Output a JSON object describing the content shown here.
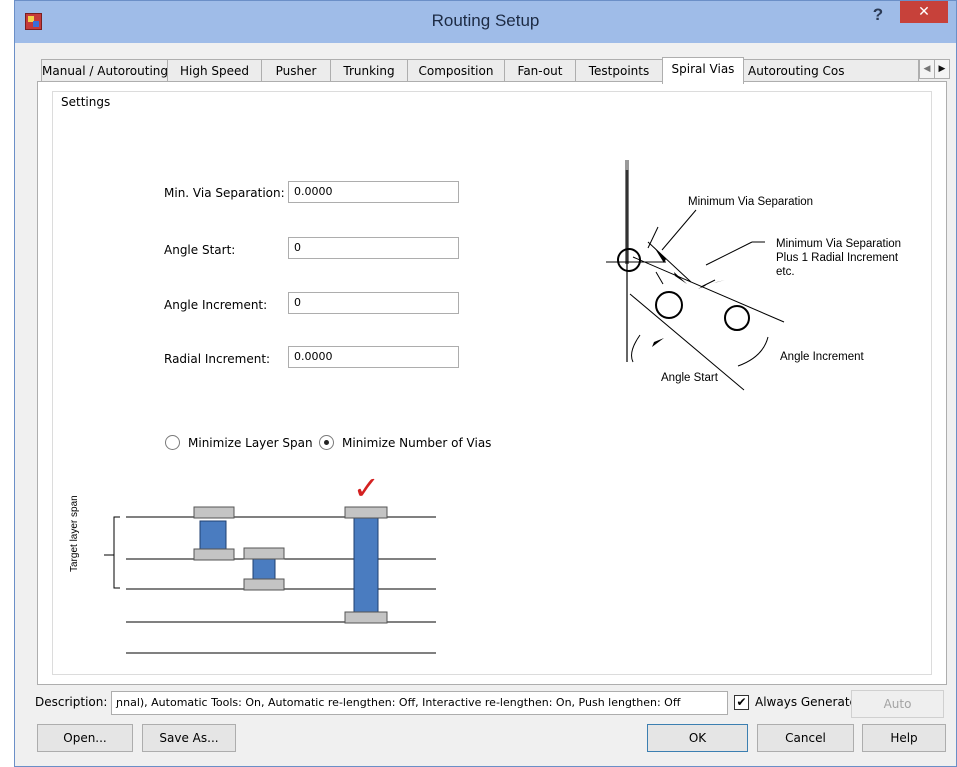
{
  "window": {
    "title": "Routing Setup",
    "help": "?",
    "close": "✕"
  },
  "tabs": [
    {
      "label": "Manual / Autorouting"
    },
    {
      "label": "High Speed"
    },
    {
      "label": "Pusher"
    },
    {
      "label": "Trunking"
    },
    {
      "label": "Composition"
    },
    {
      "label": "Fan-out"
    },
    {
      "label": "Testpoints"
    },
    {
      "label": "Spiral Vias"
    },
    {
      "label": "Autorouting Cos"
    }
  ],
  "active_tab": "Spiral Vias",
  "tab_scroll": {
    "left": "◀",
    "right": "▶"
  },
  "settings": {
    "group_label": "Settings",
    "fields": [
      {
        "label": "Min. Via Separation:",
        "value": "0.0000"
      },
      {
        "label": "Angle Start:",
        "value": "0"
      },
      {
        "label": "Angle Increment:",
        "value": "0"
      },
      {
        "label": "Radial Increment:",
        "value": "0.0000"
      }
    ],
    "radios": [
      {
        "label": "Minimize Layer Span",
        "checked": false
      },
      {
        "label": "Minimize Number of Vias",
        "checked": true
      }
    ]
  },
  "spiral_diagram": {
    "label_min_sep": "Minimum Via Separation",
    "label_plus_1": "Minimum Via Separation",
    "label_plus_2": "Plus 1 Radial Increment",
    "label_plus_3": "etc.",
    "label_angle_start": "Angle Start",
    "label_angle_increment": "Angle Increment"
  },
  "layer_diagram": {
    "axis_label": "Target layer span",
    "checkmark": "✓",
    "colors": {
      "via": "#4a7cc0",
      "pad": "#c4c4c4"
    }
  },
  "footer": {
    "description_label": "Description:",
    "description_value": "ɲnal), Automatic Tools: On, Automatic re-lengthen: Off, Interactive re-lengthen: On, Push lengthen: Off",
    "always_generate_label": "Always Generate",
    "always_generate_checked": true,
    "check_glyph": "✔",
    "auto_label": "Auto",
    "open_label": "Open...",
    "save_as_label": "Save As...",
    "ok_label": "OK",
    "cancel_label": "Cancel",
    "help_label": "Help"
  }
}
